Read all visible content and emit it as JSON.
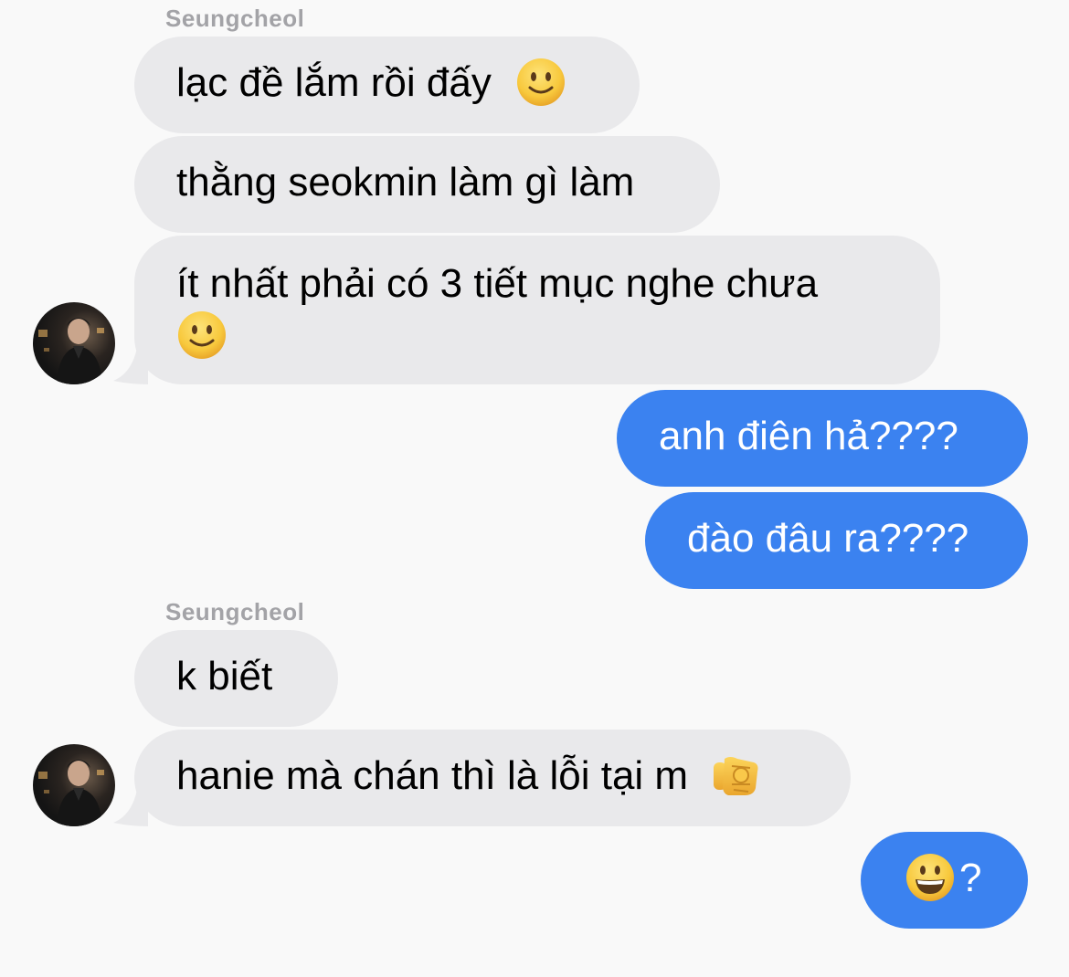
{
  "conversation": {
    "groups": [
      {
        "sender": "Seungcheol",
        "messages": [
          {
            "text": "lạc đề lắm rồi đấy",
            "emoji": "slightly-smiling-face"
          },
          {
            "text": "thằng seokmin làm gì làm"
          },
          {
            "text": "ít nhất phải có 3 tiết mục nghe chưa",
            "emoji": "slightly-smiling-face"
          }
        ]
      },
      {
        "sender": "me",
        "messages": [
          {
            "text": "anh điên hả????"
          },
          {
            "text": "đào đâu ra????"
          }
        ]
      },
      {
        "sender": "Seungcheol",
        "messages": [
          {
            "text": "k biết"
          },
          {
            "text": "hanie mà chán thì là lỗi tại m",
            "emoji": "backhand-index-pointing-at-viewer"
          }
        ]
      },
      {
        "sender": "me",
        "messages": [
          {
            "text": "?",
            "emoji": "grinning-face"
          }
        ]
      }
    ]
  },
  "colors": {
    "background": "#f9f9f9",
    "incoming_bubble": "#e9e9eb",
    "outgoing_bubble": "#3b82f0",
    "sender_name": "#a3a3a7"
  }
}
